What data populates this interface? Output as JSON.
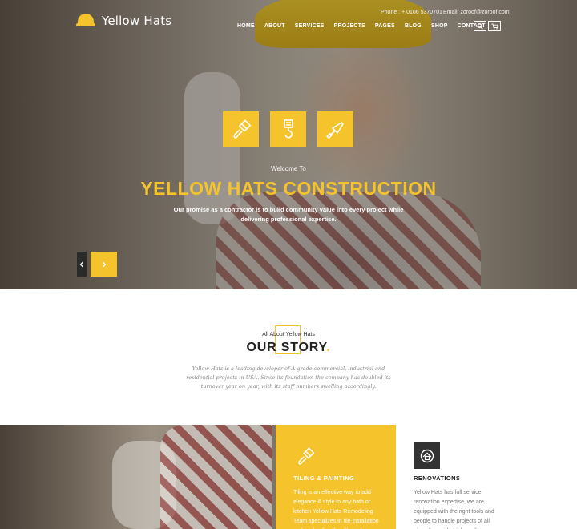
{
  "header": {
    "logo_text": "Yellow Hats",
    "phone": "Phone : + 0106 5370701",
    "email": "Email: zoroof@zoroof.com",
    "nav": [
      "HOME",
      "ABOUT",
      "SERVICES",
      "PROJECTS",
      "PAGES",
      "BLOG",
      "SHOP",
      "CONTACT"
    ],
    "tools": [
      "search-icon",
      "cart-icon"
    ]
  },
  "hero": {
    "icons": [
      "paint-brush-icon",
      "crane-hook-icon",
      "trowel-icon"
    ],
    "welcome": "Welcome To",
    "title": "YELLOW HATS CONSTRUCTION",
    "subtitle": "Our promise as a contractor is to build community value into every project while delivering professional expertise.",
    "prev_icon": "chevron-left-icon",
    "next_icon": "chevron-right-icon"
  },
  "story": {
    "eyebrow": "All About Yellow Hats",
    "title": "OUR STORY",
    "title_dot": ".",
    "text": "Yellow Hats is a leading developer of A-grade commercial, industrial and residential projects in USA. Since its foundation the company has doubled its turnover year on year, with its staff numbers swelling accordingly."
  },
  "services": [
    {
      "title": "TILING & PAINTING",
      "icon": "paint-brush-icon",
      "text": "Tiling is an effective way to add elegance & style to any bath or kitchen Yellow Hats Remodeling Team specializes in tile installation and works directly with each"
    },
    {
      "title": "RENOVATIONS",
      "icon": "renovation-badge-icon",
      "text": "Yellow Hats has full service renovation expertise, we are equipped with the right tools and people to handle projects of all sizes & provide high quality"
    }
  ],
  "colors": {
    "accent": "#f5c32c",
    "dark": "#2a2a2a"
  }
}
